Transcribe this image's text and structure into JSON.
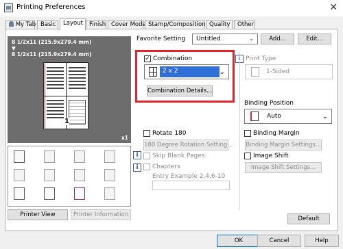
{
  "window": {
    "title": "Printing Preferences",
    "close_glyph": "✕"
  },
  "tabs": [
    "My Tab",
    "Basic",
    "Layout",
    "Finish",
    "Cover Mode",
    "Stamp/Composition",
    "Quality",
    "Other"
  ],
  "active_tab": "Layout",
  "preview": {
    "paper_line1": "8 1/2x11 (215.9x279.4 mm)",
    "arrow": "▼",
    "paper_line2": "8 1/2x11 (215.9x279.4 mm)",
    "copies": "x1",
    "page_number": "1"
  },
  "buttons": {
    "printer_view": "Printer View",
    "printer_information": "Printer Information",
    "add": "Add...",
    "edit": "Edit...",
    "combination_details": "Combination Details...",
    "rotation_settings": "180 Degree Rotation Setting...",
    "binding_margin_settings": "Binding Margin Settings...",
    "image_shift_settings": "Image Shift Settings...",
    "default": "Default",
    "ok": "OK",
    "cancel": "Cancel",
    "help": "Help"
  },
  "favorite": {
    "label": "Favorite Setting",
    "value": "Untitled"
  },
  "combination": {
    "label": "Combination",
    "checked": true,
    "value": "2 x 2"
  },
  "print_type": {
    "label": "Print Type",
    "value": "1-Sided",
    "enabled": false
  },
  "binding_position": {
    "label": "Binding Position",
    "value": "Auto"
  },
  "rotate180": {
    "label": "Rotate 180",
    "checked": false
  },
  "skip_blank": {
    "label": "Skip Blank Pages"
  },
  "chapters": {
    "label": "Chapters",
    "hint": "Entry Example 2,4,6-10",
    "value": ""
  },
  "binding_margin": {
    "label": "Binding Margin",
    "checked": false
  },
  "image_shift": {
    "label": "Image Shift",
    "checked": false
  },
  "colors": {
    "highlight": "#e3232b",
    "preview_bg": "#6d6d6d",
    "selection": "#2f6fd6"
  }
}
